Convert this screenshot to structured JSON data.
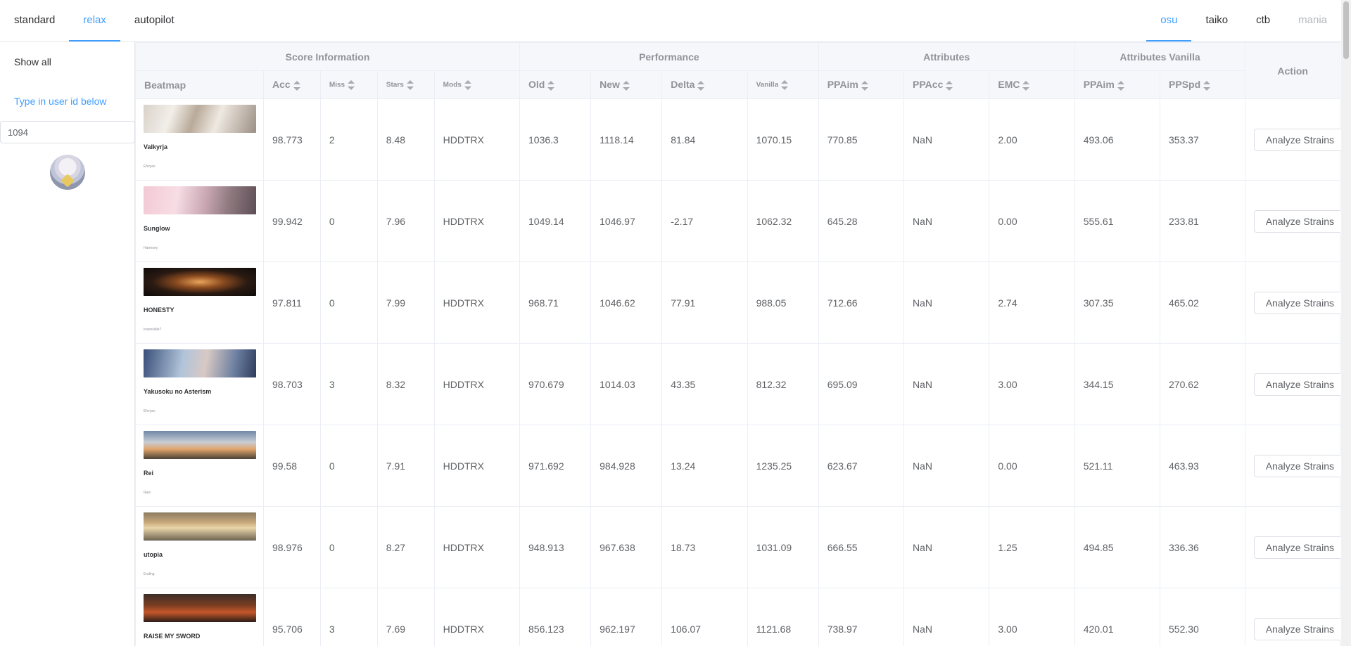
{
  "nav": {
    "left": [
      {
        "label": "standard",
        "active": false
      },
      {
        "label": "relax",
        "active": true
      },
      {
        "label": "autopilot",
        "active": false
      }
    ],
    "right": [
      {
        "label": "osu",
        "active": true,
        "disabled": false
      },
      {
        "label": "taiko",
        "active": false,
        "disabled": false
      },
      {
        "label": "ctb",
        "active": false,
        "disabled": false
      },
      {
        "label": "mania",
        "active": false,
        "disabled": true
      }
    ]
  },
  "sidebar": {
    "show_all": "Show all",
    "type_hint": "Type in user id below",
    "user_id": "1094"
  },
  "table": {
    "groups": {
      "score_info": "Score Information",
      "performance": "Performance",
      "attributes": "Attributes",
      "attributes_vanilla": "Attributes Vanilla",
      "action": "Action"
    },
    "columns": {
      "beatmap": "Beatmap",
      "acc": "Acc",
      "miss": "Miss",
      "stars": "Stars",
      "mods": "Mods",
      "old": "Old",
      "new": "New",
      "delta": "Delta",
      "vanilla": "Vanilla",
      "ppaim": "PPAim",
      "ppacc": "PPAcc",
      "emc": "EMC",
      "v_ppaim": "PPAim",
      "v_ppspd": "PPSpd"
    },
    "analyze_label": "Analyze Strains",
    "more_label": "..",
    "rows": [
      {
        "title": "Valkyrja",
        "sub": "Ehvyan",
        "acc": "98.773",
        "miss": "2",
        "stars": "8.48",
        "mods": "HDDTRX",
        "old": "1036.3",
        "new": "1118.14",
        "delta": "81.84",
        "vanilla": "1070.15",
        "ppaim": "770.85",
        "ppacc": "NaN",
        "emc": "2.00",
        "v_ppaim": "493.06",
        "v_ppspd": "353.37"
      },
      {
        "title": "Sunglow",
        "sub": "Harmony",
        "acc": "99.942",
        "miss": "0",
        "stars": "7.96",
        "mods": "HDDTRX",
        "old": "1049.14",
        "new": "1046.97",
        "delta": "-2.17",
        "vanilla": "1062.32",
        "ppaim": "645.28",
        "ppacc": "NaN",
        "emc": "0.00",
        "v_ppaim": "555.61",
        "v_ppspd": "233.81"
      },
      {
        "title": "HONESTY",
        "sub": "Insensible?",
        "acc": "97.811",
        "miss": "0",
        "stars": "7.99",
        "mods": "HDDTRX",
        "old": "968.71",
        "new": "1046.62",
        "delta": "77.91",
        "vanilla": "988.05",
        "ppaim": "712.66",
        "ppacc": "NaN",
        "emc": "2.74",
        "v_ppaim": "307.35",
        "v_ppspd": "465.02"
      },
      {
        "title": "Yakusoku no Asterism",
        "sub": "Ehvyan",
        "acc": "98.703",
        "miss": "3",
        "stars": "8.32",
        "mods": "HDDTRX",
        "old": "970.679",
        "new": "1014.03",
        "delta": "43.35",
        "vanilla": "812.32",
        "ppaim": "695.09",
        "ppacc": "NaN",
        "emc": "3.00",
        "v_ppaim": "344.15",
        "v_ppspd": "270.62"
      },
      {
        "title": "Rei",
        "sub": "Rain",
        "acc": "99.58",
        "miss": "0",
        "stars": "7.91",
        "mods": "HDDTRX",
        "old": "971.692",
        "new": "984.928",
        "delta": "13.24",
        "vanilla": "1235.25",
        "ppaim": "623.67",
        "ppacc": "NaN",
        "emc": "0.00",
        "v_ppaim": "521.11",
        "v_ppspd": "463.93"
      },
      {
        "title": "utopia",
        "sub": "Ending",
        "acc": "98.976",
        "miss": "0",
        "stars": "8.27",
        "mods": "HDDTRX",
        "old": "948.913",
        "new": "967.638",
        "delta": "18.73",
        "vanilla": "1031.09",
        "ppaim": "666.55",
        "ppacc": "NaN",
        "emc": "1.25",
        "v_ppaim": "494.85",
        "v_ppspd": "336.36"
      },
      {
        "title": "RAISE MY SWORD",
        "sub": "",
        "acc": "95.706",
        "miss": "3",
        "stars": "7.69",
        "mods": "HDDTRX",
        "old": "856.123",
        "new": "962.197",
        "delta": "106.07",
        "vanilla": "1121.68",
        "ppaim": "738.97",
        "ppacc": "NaN",
        "emc": "3.00",
        "v_ppaim": "420.01",
        "v_ppspd": "552.30"
      }
    ]
  }
}
